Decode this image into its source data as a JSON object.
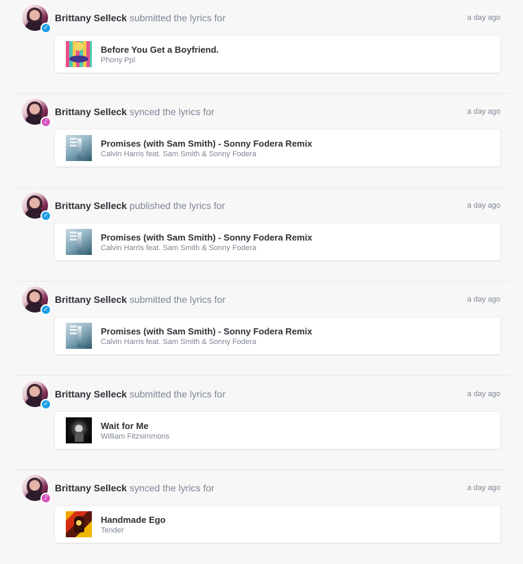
{
  "activities": [
    {
      "user": "Brittany Selleck",
      "action": "submitted the lyrics for",
      "time": "a day ago",
      "badge": "blue-check-badge",
      "song": {
        "title": "Before You Get a Boyfriend.",
        "artist": "Phony Ppl",
        "artwork": "before-you-get-a-boyfriend-album-art"
      }
    },
    {
      "user": "Brittany Selleck",
      "action": "synced the lyrics for",
      "time": "a day ago",
      "badge": "pink-music-note-badge",
      "song": {
        "title": "Promises (with Sam Smith) - Sonny Fodera Remix",
        "artist": "Calvin Harris feat. Sam Smith & Sonny Fodera",
        "artwork": "promises-album-art"
      }
    },
    {
      "user": "Brittany Selleck",
      "action": "published the lyrics for",
      "time": "a day ago",
      "badge": "blue-check-badge",
      "song": {
        "title": "Promises (with Sam Smith) - Sonny Fodera Remix",
        "artist": "Calvin Harris feat. Sam Smith & Sonny Fodera",
        "artwork": "promises-album-art"
      }
    },
    {
      "user": "Brittany Selleck",
      "action": "submitted the lyrics for",
      "time": "a day ago",
      "badge": "blue-check-badge",
      "song": {
        "title": "Promises (with Sam Smith) - Sonny Fodera Remix",
        "artist": "Calvin Harris feat. Sam Smith & Sonny Fodera",
        "artwork": "promises-album-art"
      }
    },
    {
      "user": "Brittany Selleck",
      "action": "submitted the lyrics for",
      "time": "a day ago",
      "badge": "blue-check-badge",
      "song": {
        "title": "Wait for Me",
        "artist": "William Fitzsimmons",
        "artwork": "wait-for-me-album-art"
      }
    },
    {
      "user": "Brittany Selleck",
      "action": "synced the lyrics for",
      "time": "a day ago",
      "badge": "pink-music-note-badge",
      "song": {
        "title": "Handmade Ego",
        "artist": "Tender",
        "artwork": "handmade-ego-album-art"
      }
    }
  ],
  "colors": {
    "background": "#f7f7f8",
    "primary_text": "#2f3137",
    "secondary_text": "#7d8593",
    "check_badge": "#1f9de8",
    "music_badge": "#d74fbe",
    "card": "#ffffff"
  }
}
